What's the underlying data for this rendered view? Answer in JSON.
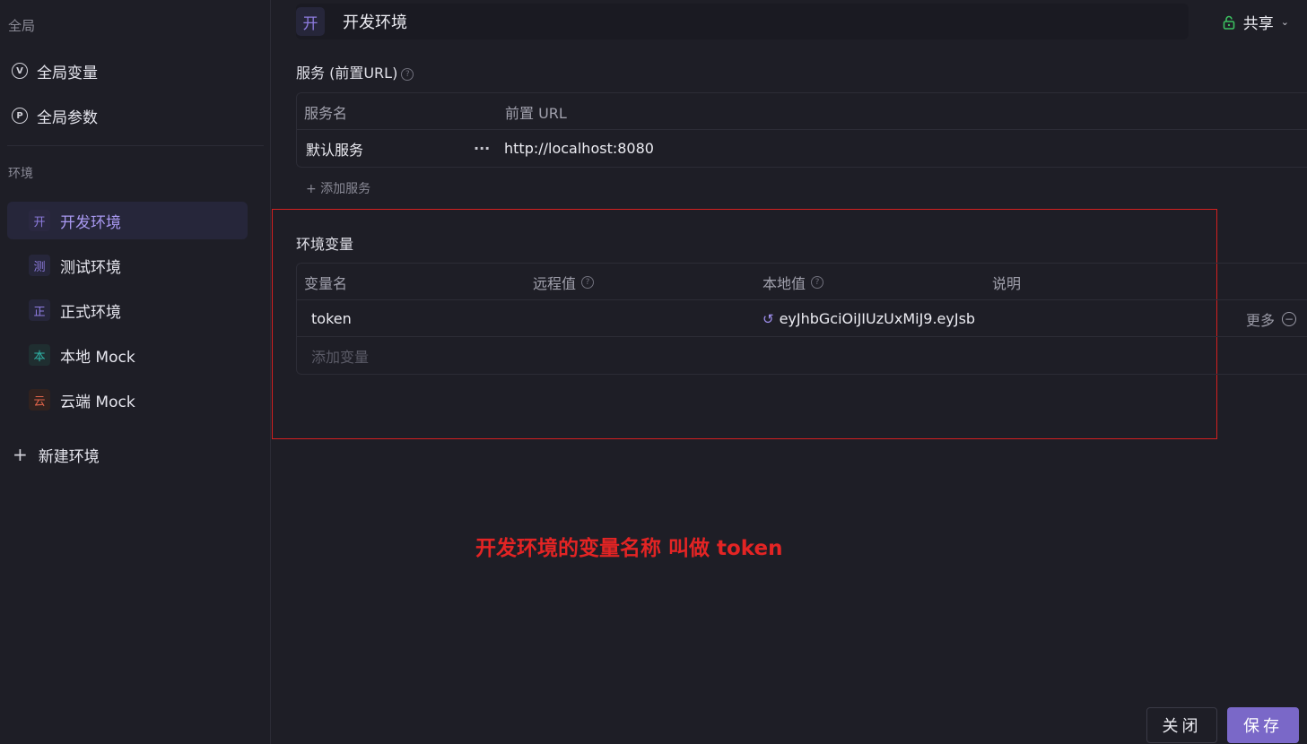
{
  "sidebar": {
    "global_title": "全局",
    "global_items": [
      {
        "icon": "V",
        "label": "全局变量"
      },
      {
        "icon": "P",
        "label": "全局参数"
      }
    ],
    "env_title": "环境",
    "envs": [
      {
        "badge": "开",
        "label": "开发环境",
        "color": "#8e7ce0",
        "active": true
      },
      {
        "badge": "测",
        "label": "测试环境",
        "color": "#8e7ce0",
        "active": false
      },
      {
        "badge": "正",
        "label": "正式环境",
        "color": "#8e7ce0",
        "active": false
      },
      {
        "badge": "本",
        "label": "本地 Mock",
        "color": "#2fb5a8",
        "active": false
      },
      {
        "badge": "云",
        "label": "云端 Mock",
        "color": "#e0644a",
        "active": false
      }
    ],
    "new_env": "新建环境"
  },
  "header": {
    "badge": "开",
    "title": "开发环境",
    "share_label": "共享",
    "lock_color": "#3cc060"
  },
  "services": {
    "title": "服务 (前置URL)",
    "help": "?",
    "col_name": "服务名",
    "col_url": "前置 URL",
    "rows": [
      {
        "name": "默认服务",
        "more": "···",
        "url": "http://localhost:8080"
      }
    ],
    "add_label": "+ 添加服务"
  },
  "env_vars": {
    "title": "环境变量",
    "col_name": "变量名",
    "col_remote": "远程值",
    "col_local": "本地值",
    "col_desc": "说明",
    "help": "?",
    "rows": [
      {
        "name": "token",
        "remote": "",
        "local": "eyJhbGciOiJIUzUxMiJ9.eyJsb",
        "desc": "",
        "more": "更多",
        "remove": "−"
      }
    ],
    "add_placeholder": "添加变量"
  },
  "annotation": "开发环境的变量名称 叫做 token",
  "buttons": {
    "close": "关闭",
    "save": "保存"
  },
  "colors": {
    "accent": "#7a68c8",
    "annotation_red": "#e32424"
  }
}
